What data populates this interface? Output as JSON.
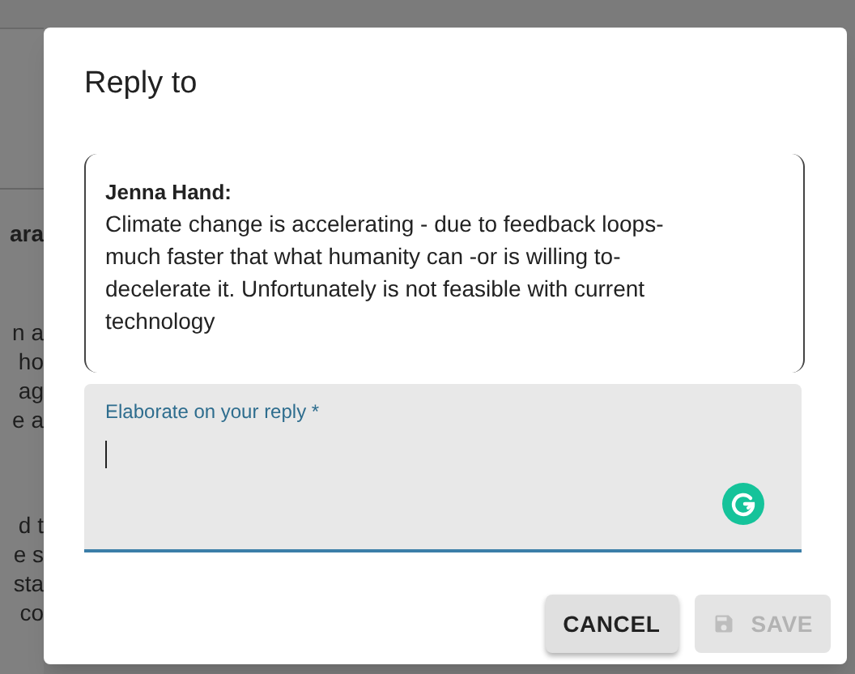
{
  "background_fragments": [
    {
      "text": "ara",
      "bold": true
    },
    {
      "text": "n a",
      "bold": false
    },
    {
      "text": "ho",
      "bold": false
    },
    {
      "text": "ag",
      "bold": false
    },
    {
      "text": "e a",
      "bold": false
    },
    {
      "text": "d t",
      "bold": false
    },
    {
      "text": "e s",
      "bold": false
    },
    {
      "text": "sta",
      "bold": false
    },
    {
      "text": "co",
      "bold": false
    }
  ],
  "dialog": {
    "title": "Reply to",
    "quote": {
      "author": "Jenna Hand:",
      "text": "Climate change is accelerating - due to feedback loops- much faster that what humanity can -or is willing to- decelerate it. Unfortunately is not feasible with current technology"
    },
    "reply_field": {
      "label": "Elaborate on your reply *",
      "focused": true
    },
    "buttons": [
      {
        "label": "CANCEL",
        "kind": "text",
        "disabled": false
      },
      {
        "label": "SAVE",
        "kind": "save",
        "disabled": true
      }
    ]
  }
}
